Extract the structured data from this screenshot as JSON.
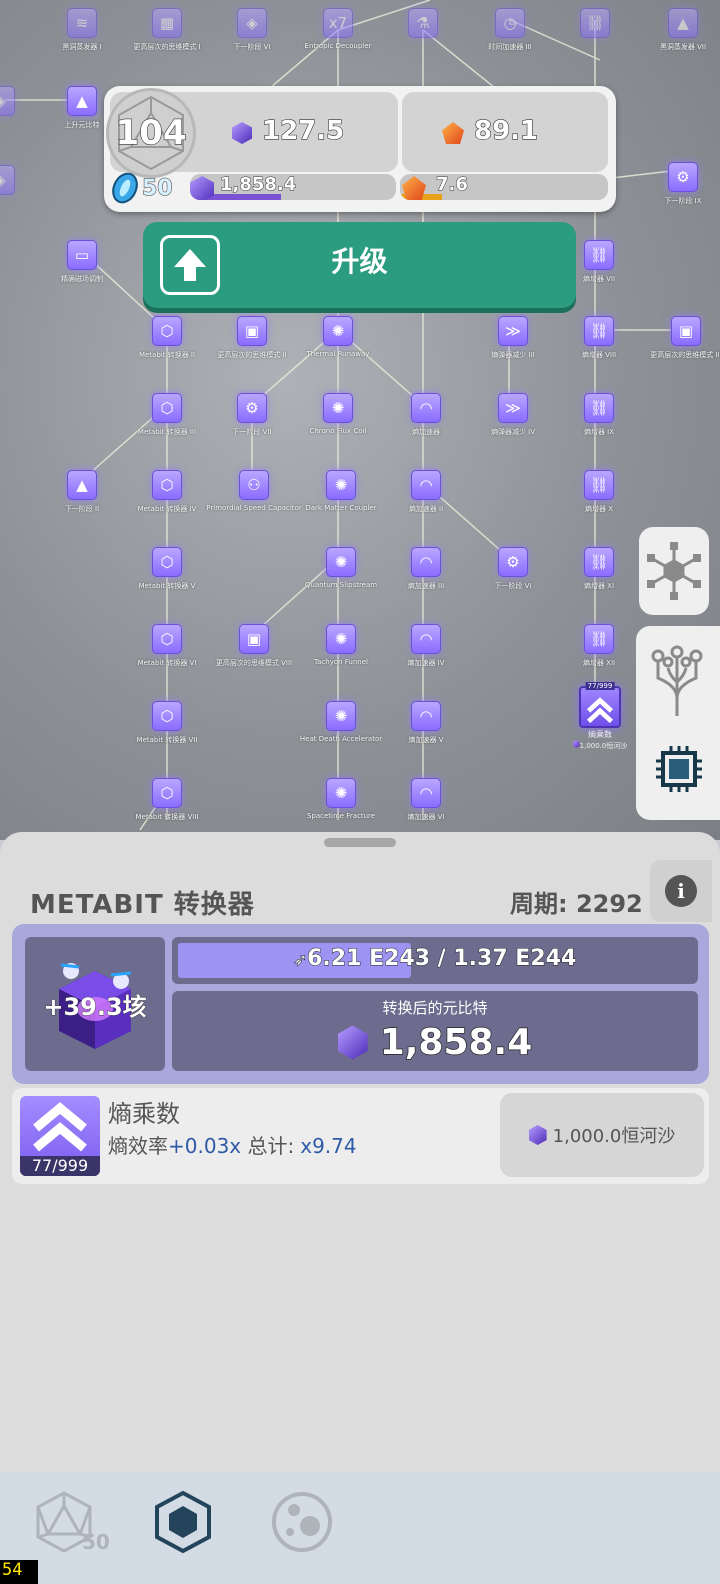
{
  "tree": {
    "nodes": [
      {
        "id": "n1",
        "label": "黑洞蒸发器 I",
        "icon": "≋"
      },
      {
        "id": "n2",
        "label": "更高层次的思维模式 I",
        "icon": "▦"
      },
      {
        "id": "n3",
        "label": "下一阶段 VI",
        "icon": "◈"
      },
      {
        "id": "n4",
        "label": "Entropic Decoupler",
        "icon": "x7"
      },
      {
        "id": "n5",
        "label": "",
        "icon": "⚗"
      },
      {
        "id": "n6",
        "label": "时间加速器 III",
        "icon": "◷"
      },
      {
        "id": "n7",
        "label": "",
        "icon": "⛓"
      },
      {
        "id": "n8",
        "label": "黑洞蒸发器 VII",
        "icon": "▲"
      },
      {
        "id": "n9",
        "label": "",
        "icon": "◈"
      },
      {
        "id": "n10",
        "label": "上升元比特",
        "icon": "▲"
      },
      {
        "id": "n11",
        "label": "",
        "icon": "◈"
      },
      {
        "id": "n12",
        "label": "下一阶段 IX",
        "icon": "⚙"
      },
      {
        "id": "n13",
        "label": "精确磁场调制",
        "icon": "▭"
      },
      {
        "id": "n14",
        "label": "熵增器 VII",
        "icon": "⛓"
      },
      {
        "id": "n15",
        "label": "Metabit 转换器 II",
        "icon": "⬡"
      },
      {
        "id": "n16",
        "label": "更高层次的思维模式 II",
        "icon": "▣"
      },
      {
        "id": "n17",
        "label": "Thermal Runaway",
        "icon": "✺"
      },
      {
        "id": "n18",
        "label": "熵弹器减少 III",
        "icon": "≫"
      },
      {
        "id": "n19",
        "label": "熵增器 VIII",
        "icon": "⛓"
      },
      {
        "id": "n20",
        "label": "更高层次的思维模式 III",
        "icon": "▣"
      },
      {
        "id": "n21",
        "label": "Metabit 转换器 III",
        "icon": "⬡"
      },
      {
        "id": "n22",
        "label": "下一阶段 VII",
        "icon": "⚙"
      },
      {
        "id": "n23",
        "label": "Chrono Flux Coil",
        "icon": "✺"
      },
      {
        "id": "n24",
        "label": "熵加速器",
        "icon": "◠"
      },
      {
        "id": "n25",
        "label": "熵弹器减少 IV",
        "icon": "≫"
      },
      {
        "id": "n26",
        "label": "熵增器 IX",
        "icon": "⛓"
      },
      {
        "id": "n27",
        "label": "下一阶段 II",
        "icon": "▲"
      },
      {
        "id": "n28",
        "label": "Metabit 转换器 IV",
        "icon": "⬡"
      },
      {
        "id": "n29",
        "label": "Primordial Speed Capacitor",
        "icon": "⚇"
      },
      {
        "id": "n30",
        "label": "Dark Matter Coupler",
        "icon": "✺"
      },
      {
        "id": "n31",
        "label": "熵加速器 II",
        "icon": "◠"
      },
      {
        "id": "n32",
        "label": "熵增器 X",
        "icon": "⛓"
      },
      {
        "id": "n33",
        "label": "Metabit 转换器 V",
        "icon": "⬡"
      },
      {
        "id": "n34",
        "label": "Quantum Slipstream",
        "icon": "✺"
      },
      {
        "id": "n35",
        "label": "熵加速器 III",
        "icon": "◠"
      },
      {
        "id": "n36",
        "label": "下一阶段 VI",
        "icon": "⚙"
      },
      {
        "id": "n37",
        "label": "熵增器 XI",
        "icon": "⛓"
      },
      {
        "id": "n38",
        "label": "Metabit 转换器 VI",
        "icon": "⬡"
      },
      {
        "id": "n39",
        "label": "更高层次的思维模式 VIII",
        "icon": "▣"
      },
      {
        "id": "n40",
        "label": "Tachyon Funnel",
        "icon": "✺"
      },
      {
        "id": "n41",
        "label": "熵加速器 IV",
        "icon": "◠"
      },
      {
        "id": "n42",
        "label": "熵增器 XII",
        "icon": "⛓"
      },
      {
        "id": "n43",
        "label": "Metabit 转换器 VII",
        "icon": "⬡"
      },
      {
        "id": "n44",
        "label": "Heat Death Accelerator",
        "icon": "✺"
      },
      {
        "id": "n45",
        "label": "熵加速器 V",
        "icon": "◠"
      },
      {
        "id": "n46",
        "label": "Metabit 转换器 VIII",
        "icon": "⬡"
      },
      {
        "id": "n47",
        "label": "Spacetime Fracture",
        "icon": "✺"
      },
      {
        "id": "n48",
        "label": "熵加速器 VI",
        "icon": "◠"
      }
    ],
    "selected": {
      "level": "77/999",
      "label": "熵乘数",
      "cost": "1,000.0恒河沙"
    }
  },
  "resources": {
    "level": "104",
    "metabit": "127.5",
    "orange": "89.1",
    "blue_count": "50",
    "metabit_bar": "1,858.4",
    "metabit_bar_fill": 0.44,
    "orange_bar": "7.6",
    "orange_bar_fill": 0.2,
    "colors": {
      "metabit_bar": "#7a52d6",
      "orange_bar": "#e8a21a"
    }
  },
  "upgrade_button": {
    "label": "升级",
    "icon": "arrow-up-icon",
    "color": "#2b9c7f"
  },
  "side_buttons": [
    {
      "name": "network-icon"
    },
    {
      "name": "tree-icon"
    },
    {
      "name": "chip-icon"
    }
  ],
  "panel": {
    "title": "METABIT 转换器",
    "cycle": "周期: 2292",
    "info": "i",
    "converter": {
      "rate": "+39.3垓",
      "progress_text": "6.21 E243 / 1.37 E244",
      "progress_fill": 0.453,
      "result_label": "转换后的元比特",
      "result_value": "1,858.4"
    },
    "multiplier": {
      "name": "熵乘数",
      "level": "77/999",
      "effect_prefix": "熵效率",
      "effect_value": "+0.03x",
      "total_label": "总计:",
      "total_value": "x9.74",
      "cost": "1,000.0恒河沙"
    }
  },
  "bottom_nav": {
    "items": [
      {
        "name": "d20-icon",
        "badge": "50"
      },
      {
        "name": "hexagon-icon"
      },
      {
        "name": "cookie-icon"
      }
    ]
  },
  "fps": "54"
}
